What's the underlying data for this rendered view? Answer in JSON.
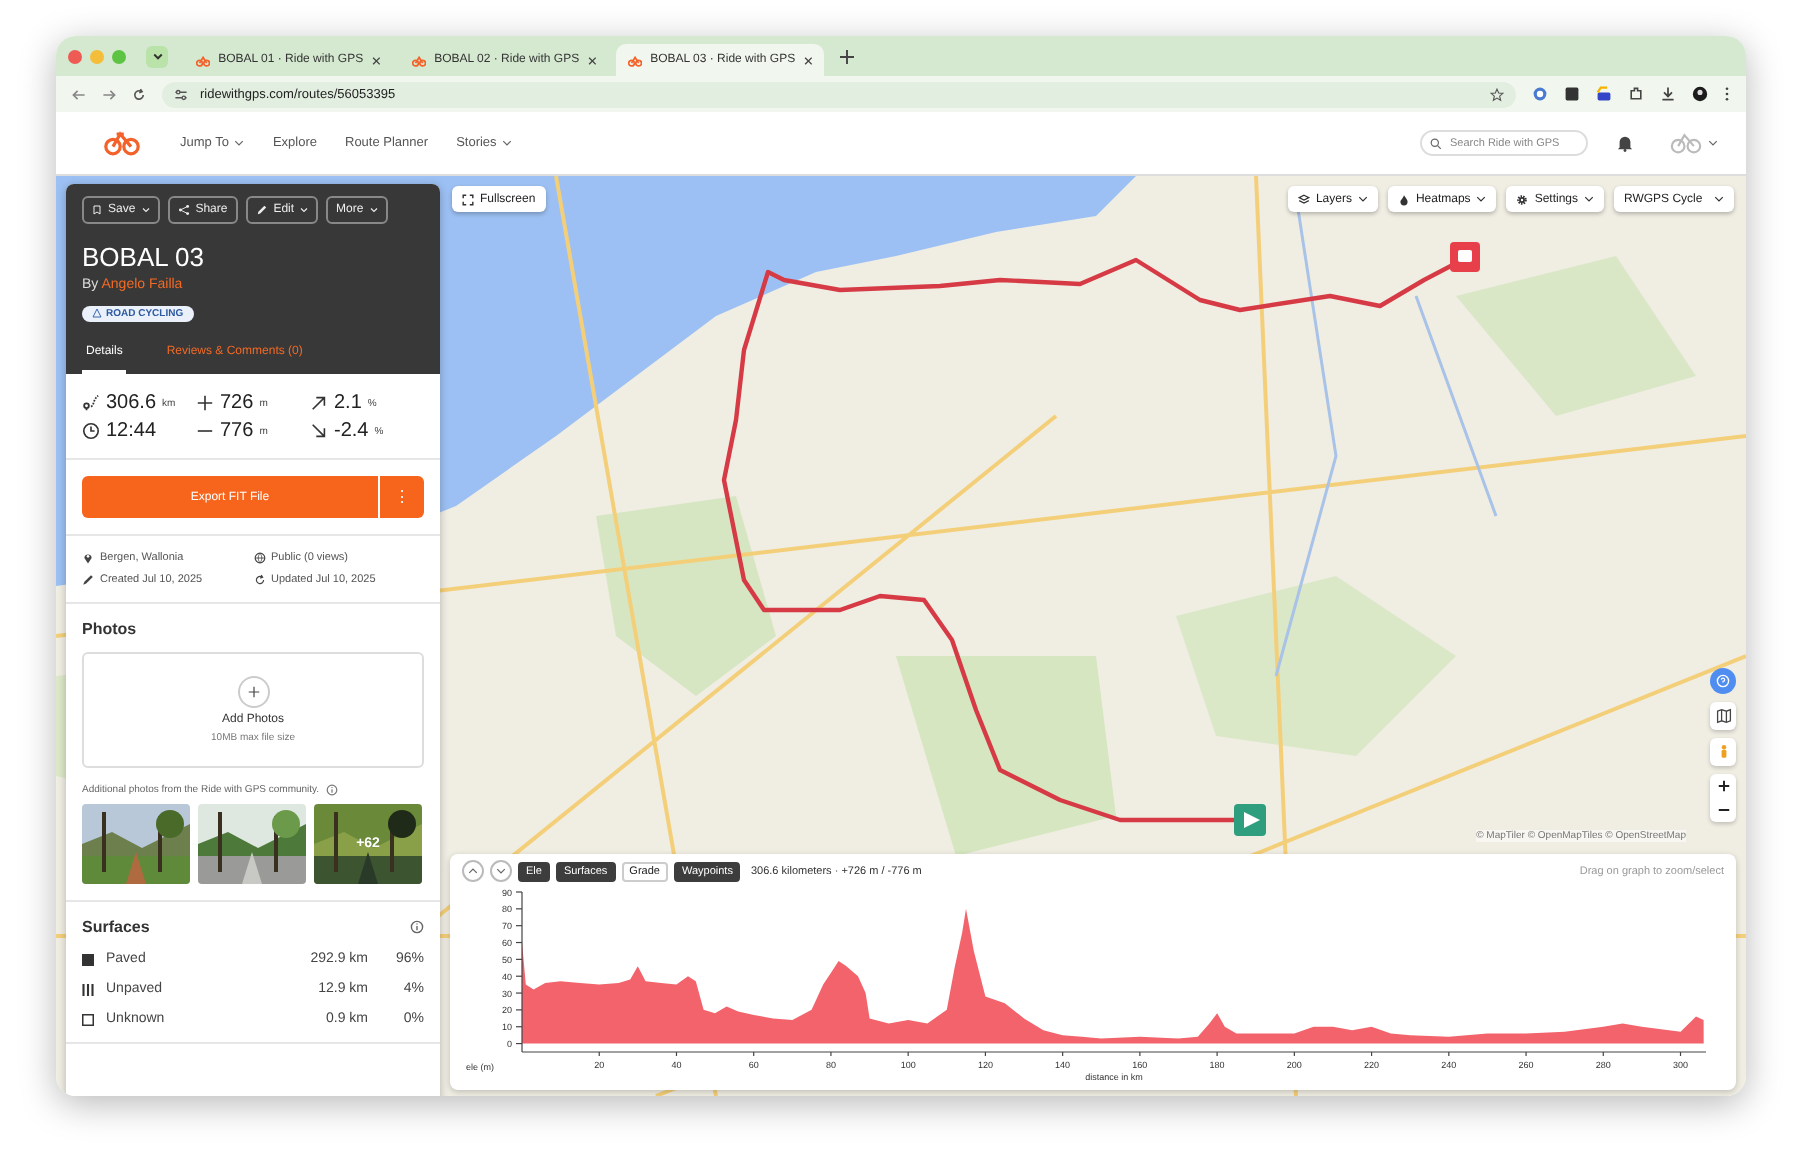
{
  "browser": {
    "tabs": [
      {
        "title": "BOBAL 01 · Ride with GPS",
        "selected": false
      },
      {
        "title": "BOBAL 02 · Ride with GPS",
        "selected": false
      },
      {
        "title": "BOBAL 03 · Ride with GPS",
        "selected": true
      }
    ],
    "url": "ridewithgps.com/routes/56053395"
  },
  "site_header": {
    "nav": [
      {
        "label": "Jump To",
        "dropdown": true
      },
      {
        "label": "Explore",
        "dropdown": false
      },
      {
        "label": "Route Planner",
        "dropdown": false
      },
      {
        "label": "Stories",
        "dropdown": true
      }
    ],
    "search": {
      "placeholder": "Search Ride with GPS"
    }
  },
  "route_card": {
    "actions": [
      {
        "kind": "save",
        "label": "Save",
        "dropdown": true
      },
      {
        "kind": "share",
        "label": "Share",
        "dropdown": false
      },
      {
        "kind": "edit",
        "label": "Edit",
        "dropdown": true
      },
      {
        "kind": "more",
        "label": "More",
        "dropdown": true
      }
    ],
    "title": "BOBAL 03",
    "by": "By",
    "author": "Angelo Failla",
    "badge": "ROAD CYCLING",
    "tabs": [
      {
        "label": "Details",
        "selected": true
      },
      {
        "label": "Reviews & Comments (0)",
        "selected": false
      }
    ],
    "stats": [
      {
        "kind": "distance",
        "value": "306.6",
        "unit": "km"
      },
      {
        "kind": "climb",
        "value": "726",
        "unit": "m"
      },
      {
        "kind": "grade_up",
        "value": "2.1",
        "unit": "%"
      },
      {
        "kind": "time",
        "value": "12:44"
      },
      {
        "kind": "descent",
        "value": "776",
        "unit": "m"
      },
      {
        "kind": "grade_down",
        "value": "-2.4",
        "unit": "%"
      }
    ],
    "export_button": "Export FIT File",
    "menu_button": "⋮",
    "info": [
      {
        "kind": "location",
        "text": "Bergen, Wallonia"
      },
      {
        "kind": "visibility",
        "text": "Public (0 views)"
      },
      {
        "kind": "created",
        "text": "Created Jul 10, 2025"
      },
      {
        "kind": "updated",
        "text": "Updated Jul 10, 2025"
      }
    ]
  },
  "photos": {
    "title": "Photos",
    "add_label": "Add Photos",
    "add_hint": "10MB max file size",
    "community_note": "Additional photos from the Ride with GPS community.",
    "thumbnails": [
      {
        "kind": "picture"
      },
      {
        "kind": "picture"
      },
      {
        "kind": "picture",
        "overlay": "+62"
      }
    ]
  },
  "surfaces": {
    "title": "Surfaces",
    "rows": [
      {
        "kind": "paved",
        "label": "Paved",
        "distance": "292.9 km",
        "percent": "96%"
      },
      {
        "kind": "unpaved",
        "label": "Unpaved",
        "distance": "12.9 km",
        "percent": "4%"
      },
      {
        "kind": "unknown",
        "label": "Unknown",
        "distance": "0.9 km",
        "percent": "0%"
      }
    ]
  },
  "map": {
    "fullscreen": "Fullscreen",
    "menus": [
      {
        "kind": "layers",
        "label": "Layers"
      },
      {
        "kind": "heatmaps",
        "label": "Heatmaps"
      },
      {
        "kind": "settings",
        "label": "Settings"
      },
      {
        "kind": "style",
        "label": "RWGPS Cycle"
      }
    ],
    "attribution": "© MapTiler © OpenMapTiles © OpenStreetMap"
  },
  "elevation": {
    "toggles": [
      {
        "label": "Ele",
        "selected": true
      },
      {
        "label": "Surfaces",
        "selected": true
      },
      {
        "label": "Grade",
        "selected": false
      },
      {
        "label": "Waypoints",
        "selected": true
      }
    ],
    "summary": "306.6 kilometers · +726 m / -776 m",
    "hint": "Drag on graph to zoom/select",
    "chart_data": {
      "type": "area",
      "xlabel": "distance in km",
      "ylabel": "ele (m)",
      "x": [
        0,
        1,
        3,
        6,
        10,
        15,
        20,
        25,
        28,
        30,
        32,
        36,
        40,
        43,
        45,
        47,
        50,
        53,
        56,
        60,
        65,
        70,
        75,
        78,
        80,
        82,
        84,
        87,
        89,
        90,
        95,
        100,
        105,
        110,
        112,
        114,
        115,
        117,
        120,
        125,
        130,
        135,
        140,
        145,
        150,
        160,
        170,
        175,
        178,
        180,
        182,
        185,
        190,
        200,
        205,
        210,
        215,
        220,
        225,
        230,
        240,
        250,
        260,
        270,
        280,
        285,
        290,
        300,
        304,
        306
      ],
      "series": [
        {
          "color": "#f2636b",
          "values": [
            60,
            35,
            32,
            36,
            37,
            36,
            35,
            36,
            38,
            46,
            37,
            36,
            35,
            40,
            37,
            20,
            18,
            22,
            19,
            17,
            15,
            14,
            20,
            35,
            42,
            49,
            46,
            40,
            30,
            15,
            12,
            14,
            12,
            20,
            45,
            66,
            80,
            55,
            28,
            24,
            15,
            8,
            5,
            4,
            3,
            4,
            3,
            4,
            12,
            18,
            10,
            6,
            6,
            6,
            10,
            10,
            8,
            10,
            6,
            5,
            4,
            6,
            6,
            7,
            10,
            12,
            10,
            7,
            16,
            14
          ]
        }
      ],
      "xlim": [
        0,
        306.6
      ],
      "ylim": [
        -5,
        90
      ],
      "xticks": [
        20,
        40,
        60,
        80,
        100,
        120,
        140,
        160,
        180,
        200,
        220,
        240,
        260,
        280,
        300
      ],
      "yticks": [
        0,
        10,
        20,
        30,
        40,
        50,
        60,
        70,
        80,
        90
      ]
    }
  }
}
